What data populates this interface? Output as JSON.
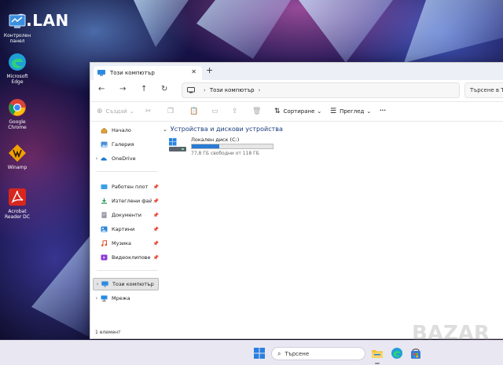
{
  "desktop": {
    "overlay_title": "C.LAN",
    "icons": [
      {
        "label": "Контролен панел",
        "icon": "control-panel-icon"
      },
      {
        "label": "Microsoft Edge",
        "icon": "edge-icon"
      },
      {
        "label": "Google Chrome",
        "icon": "chrome-icon"
      },
      {
        "label": "Winamp",
        "icon": "winamp-icon"
      },
      {
        "label": "Acrobat Reader DC",
        "icon": "acrobat-icon"
      }
    ]
  },
  "window": {
    "tab_title": "Този компютър",
    "address_segment": "Този компютър",
    "search_placeholder": "Търсене в Т",
    "toolbar": {
      "new_label": "Създай",
      "sort_label": "Сортиране",
      "view_label": "Преглед",
      "more_label": "···"
    },
    "sidebar": {
      "items": [
        {
          "label": "Начало",
          "icon": "home-icon"
        },
        {
          "label": "Галерия",
          "icon": "gallery-icon"
        },
        {
          "label": "OneDrive",
          "icon": "onedrive-icon"
        },
        {
          "label": "Работен плот",
          "icon": "desktop-folder-icon"
        },
        {
          "label": "Изтеглени файлове",
          "icon": "downloads-icon"
        },
        {
          "label": "Документи",
          "icon": "documents-icon"
        },
        {
          "label": "Картини",
          "icon": "pictures-icon"
        },
        {
          "label": "Музика",
          "icon": "music-icon"
        },
        {
          "label": "Видеоклипове",
          "icon": "videos-icon"
        },
        {
          "label": "Този компютър",
          "icon": "computer-icon"
        },
        {
          "label": "Мрежа",
          "icon": "network-icon"
        }
      ]
    },
    "group_header": "Устройства и дискови устройства",
    "drive": {
      "name": "Локален диск (C:)",
      "free_text": "77,8 ГБ свободни от 118 ГБ",
      "used_fraction": 0.34
    },
    "status": "1 елемент"
  },
  "taskbar": {
    "search_placeholder": "Търсене"
  },
  "watermark": "BAZAR",
  "colors": {
    "accent": "#2a7bd4",
    "window_bg": "#ffffff",
    "taskbar_bg": "#e9e7f1"
  }
}
